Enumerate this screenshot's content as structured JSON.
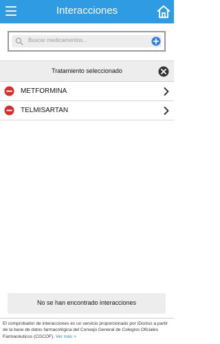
{
  "appbar": {
    "title": "Interacciones",
    "menu_icon": "hamburger-menu-icon",
    "home_icon": "home-icon",
    "color": "#2F9BE3"
  },
  "search": {
    "placeholder": "Buscar medicamentos...",
    "search_icon": "search-icon",
    "add_icon": "add-circle-icon"
  },
  "treatment": {
    "header": "Tratamiento seleccionado",
    "close_icon": "close-circle-icon",
    "items": [
      {
        "name": "METFORMINA",
        "icon": "remove-circle-icon"
      },
      {
        "name": "TELMISARTAN",
        "icon": "remove-circle-icon"
      }
    ],
    "remove_color": "#D32F2F"
  },
  "result": {
    "message": "No se han encontrado interacciones"
  },
  "footer": {
    "text": "El comprobador de interacciones es un servicio proporcionado por iDoctus a partir de la base de datos farmacológica del Consejo General de Colegios Oficiales Farmacéuticos (CGCOF).",
    "more_label": "Ver más >"
  }
}
